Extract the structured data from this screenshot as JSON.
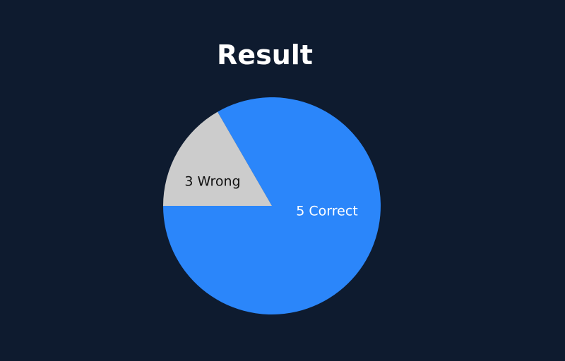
{
  "title": "Result",
  "chart_data": {
    "type": "pie",
    "title": "Result",
    "slices": [
      {
        "label": "5 Correct",
        "value": 5,
        "color": "#2b86fa",
        "text_color": "#ffffff"
      },
      {
        "label": "3 Wrong",
        "value": 1,
        "color": "#cccccc",
        "text_color": "#111111"
      }
    ]
  }
}
